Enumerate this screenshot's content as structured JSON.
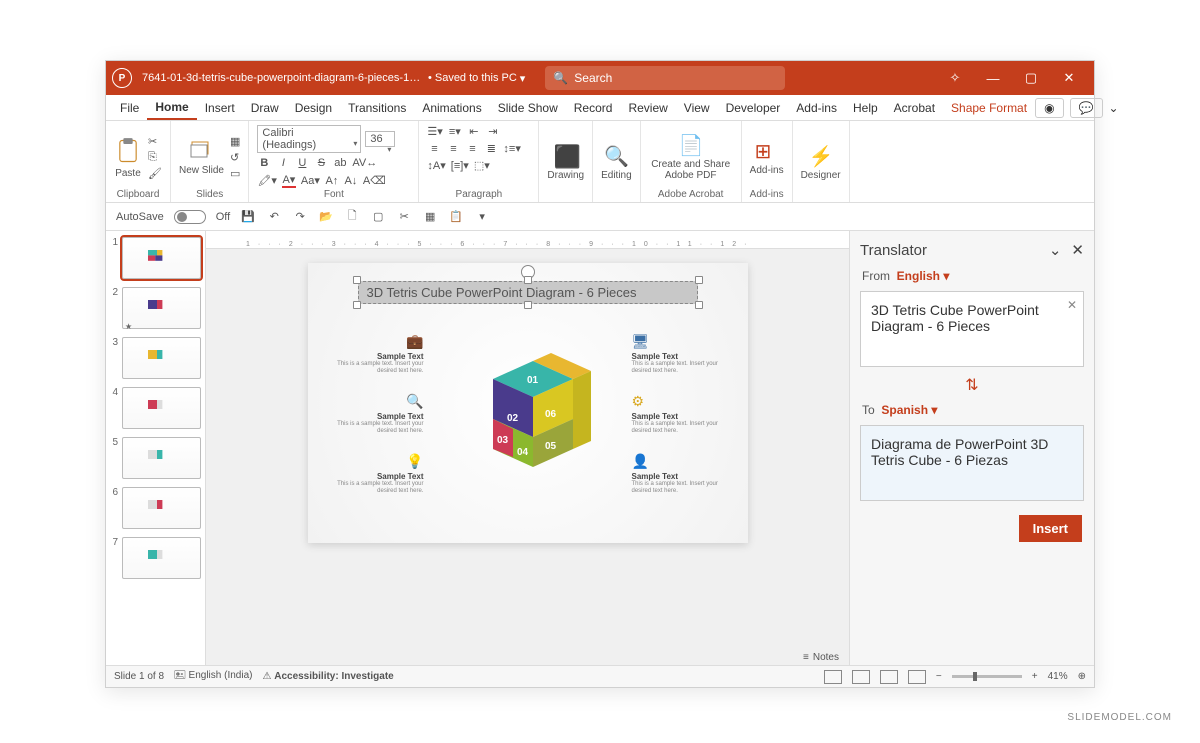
{
  "titlebar": {
    "filename": "7641-01-3d-tetris-cube-powerpoint-diagram-6-pieces-16x...",
    "saved": "Saved to this PC",
    "search_placeholder": "Search"
  },
  "tabs": [
    "File",
    "Home",
    "Insert",
    "Draw",
    "Design",
    "Transitions",
    "Animations",
    "Slide Show",
    "Record",
    "Review",
    "View",
    "Developer",
    "Add-ins",
    "Help",
    "Acrobat",
    "Shape Format"
  ],
  "activeTab": "Home",
  "accentTab": "Shape Format",
  "ribbon": {
    "groups": [
      "Clipboard",
      "Slides",
      "Font",
      "Paragraph",
      "",
      "",
      "Adobe Acrobat",
      "Add-ins",
      ""
    ],
    "paste": "Paste",
    "newslide": "New Slide",
    "font_name": "Calibri (Headings)",
    "font_size": "36",
    "drawing": "Drawing",
    "editing": "Editing",
    "adobe": "Create and Share Adobe PDF",
    "addins": "Add-ins",
    "designer": "Designer"
  },
  "qat": {
    "autosave": "AutoSave",
    "off": "Off"
  },
  "thumbs": [
    1,
    2,
    3,
    4,
    5,
    6,
    7
  ],
  "selectedThumb": 1,
  "slide": {
    "title": "3D Tetris Cube PowerPoint Diagram - 6 Pieces",
    "sample_title": "Sample Text",
    "sample_desc": "This is a sample text. Insert your desired text here.",
    "nums": [
      "01",
      "02",
      "03",
      "04",
      "05",
      "06"
    ]
  },
  "translator": {
    "title": "Translator",
    "from_label": "From",
    "from_lang": "English",
    "source_text": "3D Tetris Cube PowerPoint Diagram - 6 Pieces",
    "to_label": "To",
    "to_lang": "Spanish",
    "result_text": "Diagrama de PowerPoint 3D Tetris Cube - 6 Piezas",
    "insert": "Insert"
  },
  "status": {
    "slide": "Slide 1 of 8",
    "lang": "English (India)",
    "access": "Accessibility: Investigate",
    "notes": "Notes",
    "zoom": "41%"
  },
  "ruler": "1···2···3···4···5···6···7···8···9···10··11··12·",
  "watermark": "SLIDEMODEL.COM"
}
